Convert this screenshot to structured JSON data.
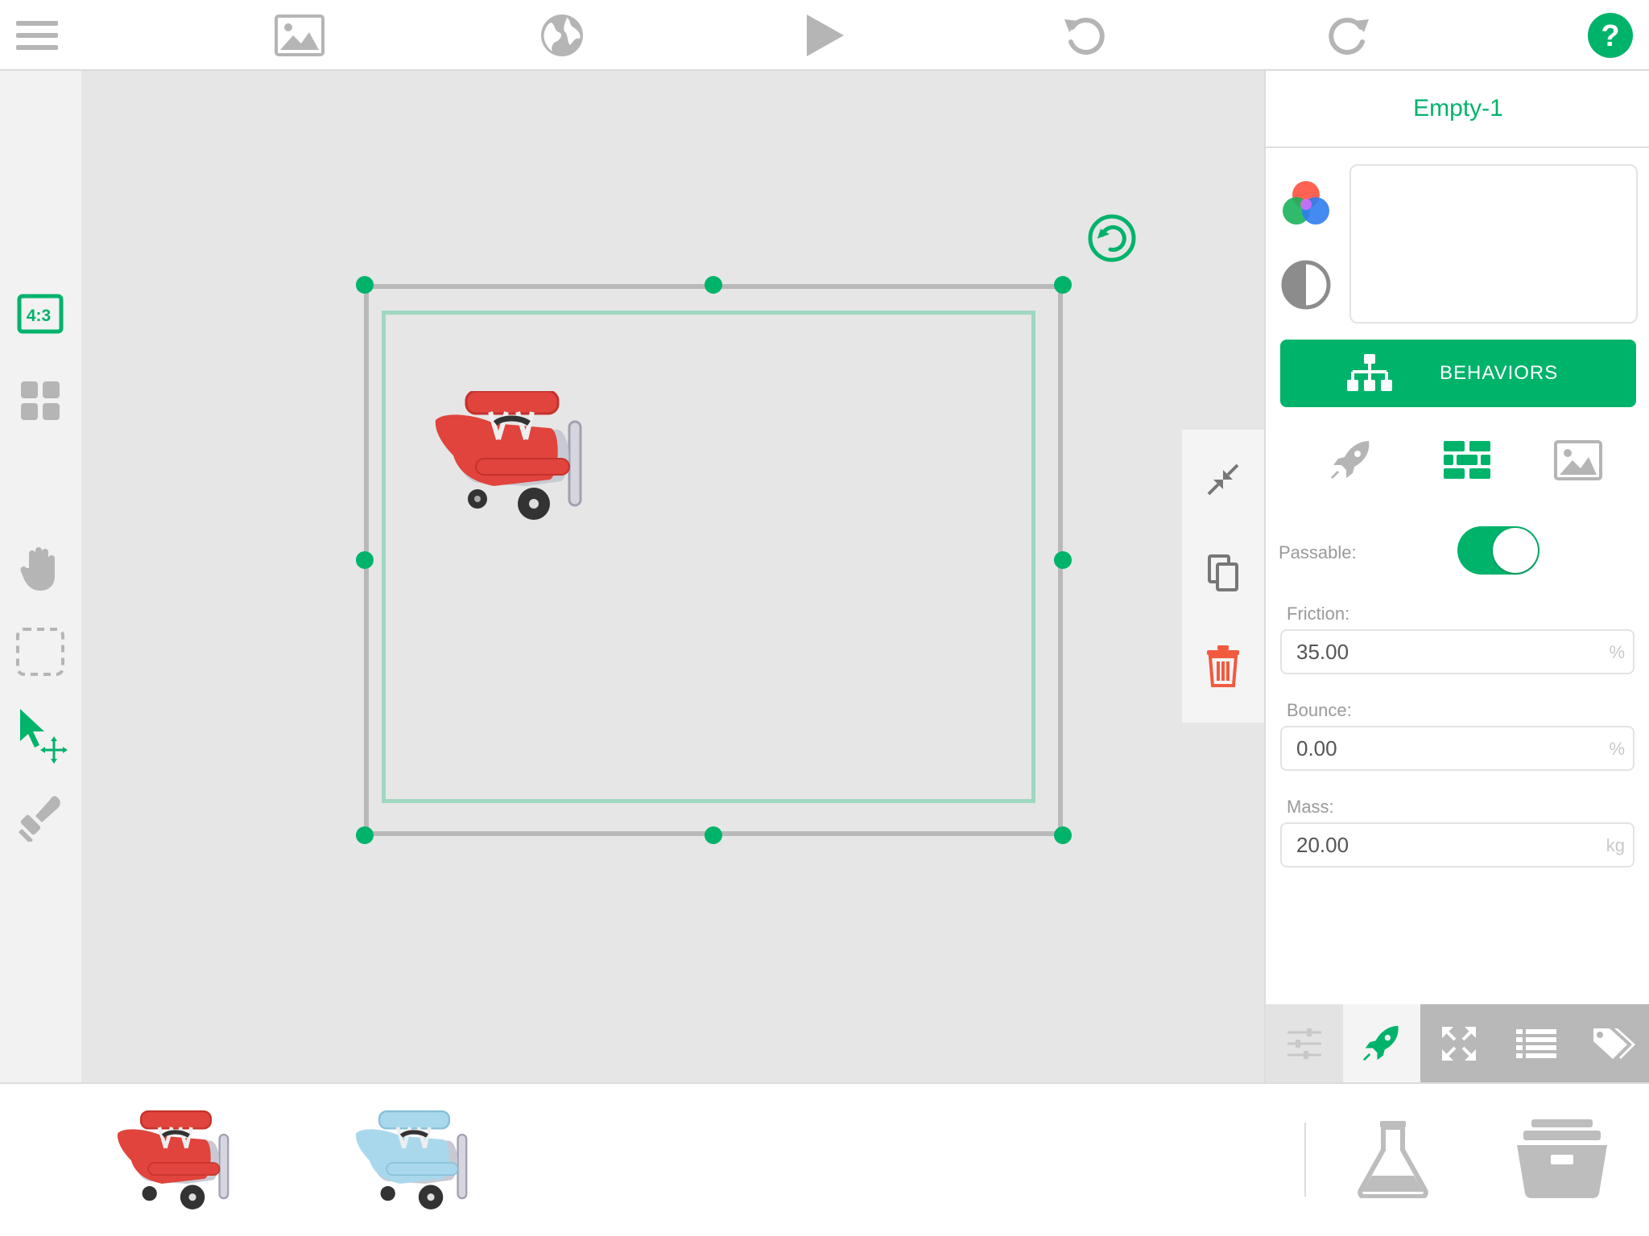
{
  "toolbar": {
    "items": [
      {
        "name": "menu",
        "icon": "hamburger-menu-icon"
      },
      {
        "name": "scene-image",
        "icon": "image-icon"
      },
      {
        "name": "world",
        "icon": "globe-icon"
      },
      {
        "name": "play",
        "icon": "play-icon"
      },
      {
        "name": "undo",
        "icon": "undo-icon"
      },
      {
        "name": "redo",
        "icon": "redo-icon"
      },
      {
        "name": "help",
        "icon": "help-icon",
        "label": "?"
      }
    ]
  },
  "left_tools": {
    "aspect_ratio_label": "4:3",
    "items": [
      {
        "name": "aspect-ratio",
        "icon": "aspect-ratio-icon"
      },
      {
        "name": "grid",
        "icon": "grid-icon"
      },
      {
        "name": "pan",
        "icon": "hand-icon"
      },
      {
        "name": "marquee-select",
        "icon": "dashed-selection-icon"
      },
      {
        "name": "select-move",
        "icon": "select-move-arrow-icon",
        "active": true
      },
      {
        "name": "stamp",
        "icon": "stamp-icon"
      }
    ]
  },
  "context_tools": [
    {
      "name": "shrink",
      "icon": "shrink-arrows-icon"
    },
    {
      "name": "duplicate",
      "icon": "copy-icon"
    },
    {
      "name": "delete",
      "icon": "trash-icon"
    }
  ],
  "inspector": {
    "title": "Empty-1",
    "behaviors_label": "BEHAVIORS",
    "subtabs": [
      {
        "name": "motion",
        "icon": "rocket-icon"
      },
      {
        "name": "physics",
        "icon": "bricks-icon",
        "active": true
      },
      {
        "name": "appearance",
        "icon": "image-icon"
      }
    ],
    "passable_label": "Passable:",
    "passable": true,
    "fields": {
      "friction": {
        "label": "Friction:",
        "value": "35.00",
        "unit": "%"
      },
      "bounce": {
        "label": "Bounce:",
        "value": "0.00",
        "unit": "%"
      },
      "mass": {
        "label": "Mass:",
        "value": "20.00",
        "unit": "kg"
      }
    },
    "bottom_tabs": [
      {
        "name": "sliders",
        "icon": "sliders-icon"
      },
      {
        "name": "behaviors",
        "icon": "rocket-icon",
        "active": true
      },
      {
        "name": "transform",
        "icon": "expand-arrows-icon"
      },
      {
        "name": "list",
        "icon": "list-icon"
      },
      {
        "name": "tags",
        "icon": "tags-icon"
      }
    ]
  },
  "assets": [
    {
      "name": "red-biplane",
      "color": "#e0443c"
    },
    {
      "name": "blue-biplane",
      "color": "#a9d8ec"
    }
  ],
  "colors": {
    "accent": "#00b36b",
    "danger": "#f25a3f",
    "icon_gray": "#b5b5b5",
    "canvas": "#e6e6e6"
  }
}
